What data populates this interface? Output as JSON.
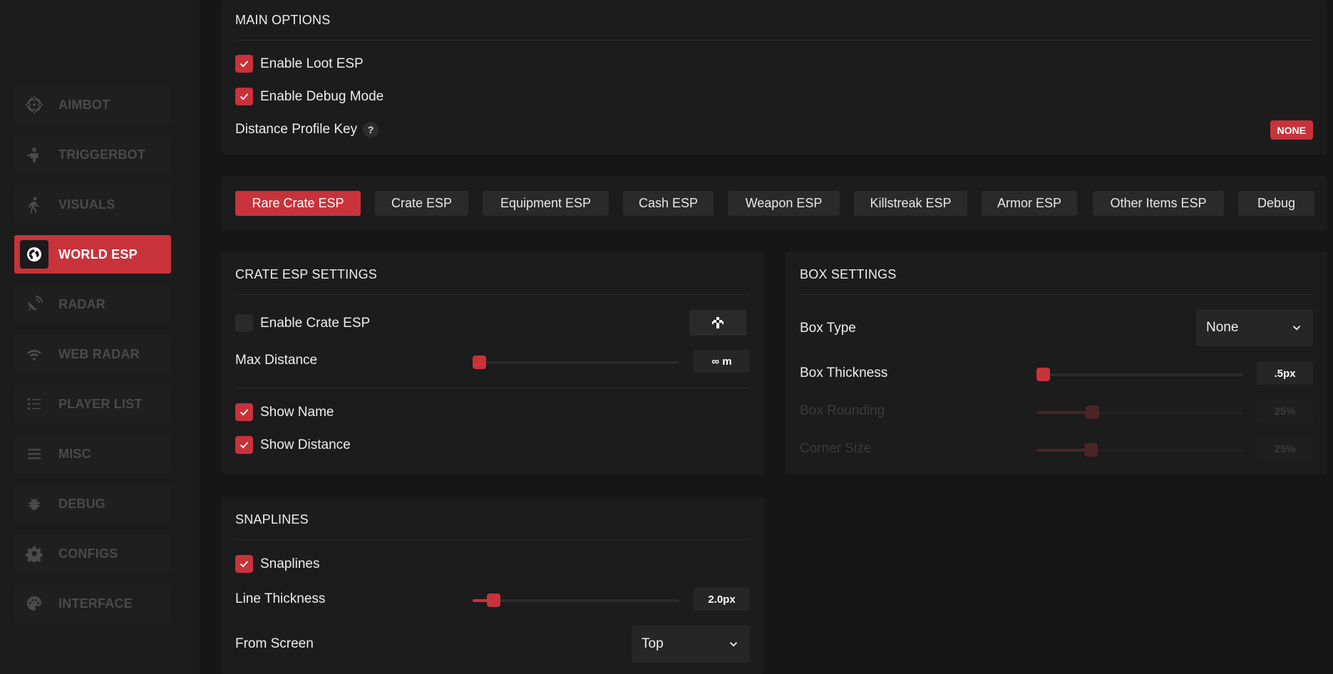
{
  "sidebar": {
    "items": [
      {
        "label": "AIMBOT",
        "icon": "crosshair-icon"
      },
      {
        "label": "TRIGGERBOT",
        "icon": "soldier-icon"
      },
      {
        "label": "VISUALS",
        "icon": "person-walking-icon"
      },
      {
        "label": "WORLD ESP",
        "icon": "globe-icon",
        "active": true
      },
      {
        "label": "RADAR",
        "icon": "satellite-dish-icon"
      },
      {
        "label": "WEB RADAR",
        "icon": "wifi-icon"
      },
      {
        "label": "PLAYER LIST",
        "icon": "list-icon"
      },
      {
        "label": "MISC",
        "icon": "menu-icon"
      },
      {
        "label": "DEBUG",
        "icon": "bug-icon"
      },
      {
        "label": "CONFIGS",
        "icon": "gear-icon"
      },
      {
        "label": "INTERFACE",
        "icon": "palette-icon"
      }
    ]
  },
  "main_options": {
    "title": "MAIN OPTIONS",
    "enable_loot_esp": {
      "label": "Enable Loot ESP",
      "checked": true
    },
    "enable_debug_mode": {
      "label": "Enable Debug Mode",
      "checked": true
    },
    "distance_profile_key": {
      "label": "Distance Profile Key",
      "help": "?",
      "key": "NONE"
    }
  },
  "tabs": [
    {
      "label": "Rare Crate ESP",
      "active": true
    },
    {
      "label": "Crate ESP"
    },
    {
      "label": "Equipment ESP"
    },
    {
      "label": "Cash ESP"
    },
    {
      "label": "Weapon ESP"
    },
    {
      "label": "Killstreak ESP"
    },
    {
      "label": "Armor ESP"
    },
    {
      "label": "Other Items ESP"
    },
    {
      "label": "Debug"
    }
  ],
  "crate_esp_settings": {
    "title": "CRATE ESP SETTINGS",
    "enable_crate_esp": {
      "label": "Enable Crate ESP",
      "checked": false
    },
    "max_distance": {
      "label": "Max Distance",
      "value": "∞ m",
      "fraction": 0.0
    },
    "show_name": {
      "label": "Show Name",
      "checked": true
    },
    "show_distance": {
      "label": "Show Distance",
      "checked": true
    }
  },
  "box_settings": {
    "title": "BOX SETTINGS",
    "box_type": {
      "label": "Box Type",
      "value": "None"
    },
    "box_thickness": {
      "label": "Box Thickness",
      "value": ".5px",
      "fraction": 0.0
    },
    "box_rounding": {
      "label": "Box Rounding",
      "value": "25%",
      "fraction": 0.25,
      "disabled": true
    },
    "corner_size": {
      "label": "Corner Size",
      "value": "25%",
      "fraction": 0.25,
      "disabled": true
    }
  },
  "snaplines": {
    "title": "SNAPLINES",
    "snaplines": {
      "label": "Snaplines",
      "checked": true
    },
    "line_thickness": {
      "label": "Line Thickness",
      "value": "2.0px",
      "fraction": 0.1
    },
    "from_screen": {
      "label": "From Screen",
      "value": "Top"
    }
  },
  "colors": {
    "accent": "#c8333b",
    "background": "#161616",
    "panel": "#1c1c1c"
  }
}
